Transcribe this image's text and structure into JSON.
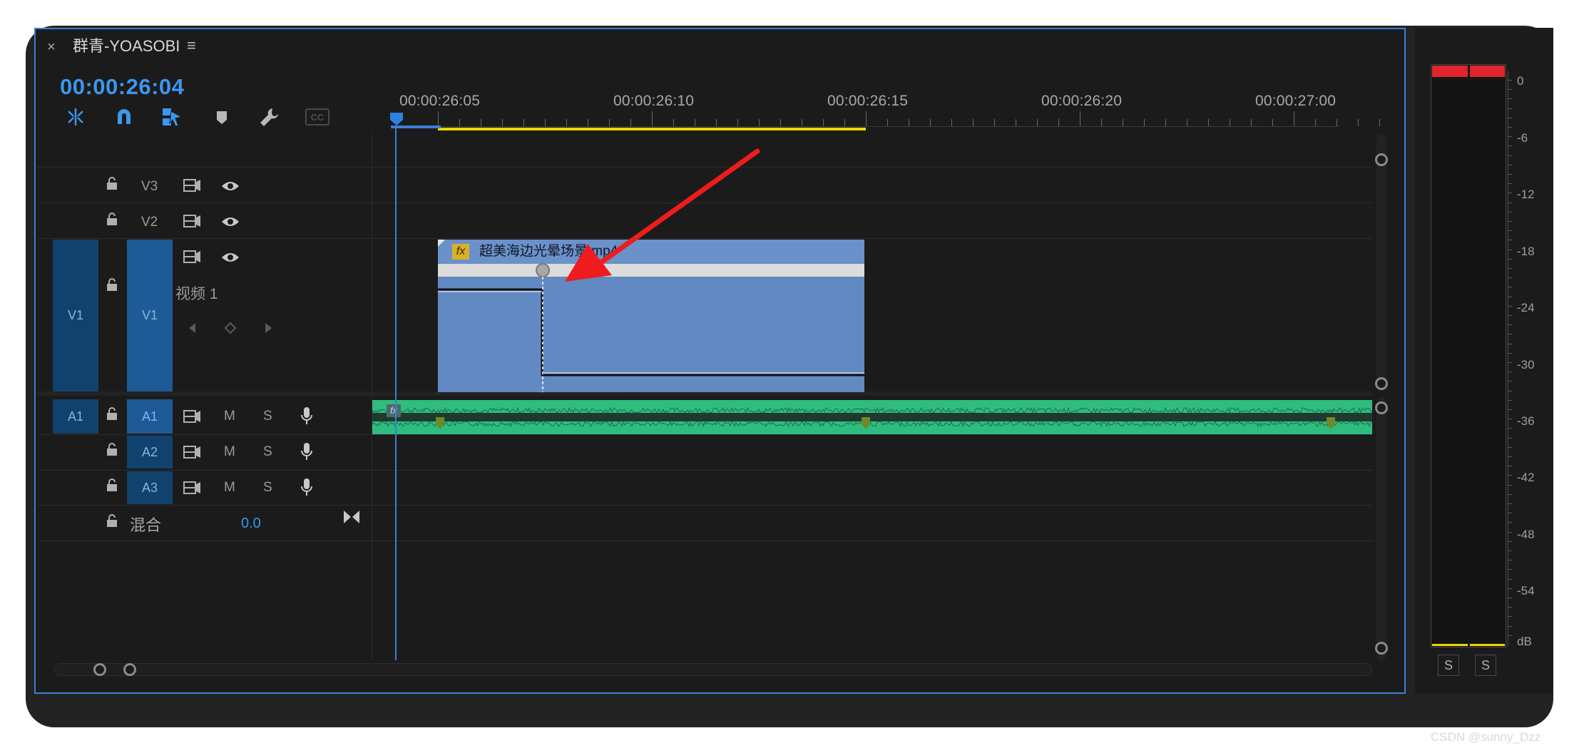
{
  "panel": {
    "close_glyph": "×",
    "title": "群青-YOASOBI",
    "menu_glyph": "≡",
    "timecode": "00:00:26:04"
  },
  "toolbar": {
    "tools": [
      "insert-snap-icon",
      "magnet-snap-icon",
      "linked-selection-icon",
      "add-marker-icon",
      "wrench-settings-icon",
      "captions-icon"
    ],
    "captions_label": "CC"
  },
  "ruler": {
    "labels": [
      "00:00:26:05",
      "00:00:26:10",
      "00:00:26:15",
      "00:00:26:20",
      "00:00:27:00"
    ]
  },
  "tracks": {
    "video": [
      {
        "name": "V3"
      },
      {
        "name": "V2"
      },
      {
        "source": "V1",
        "name": "V1",
        "track_name": "视频 1"
      }
    ],
    "audio": [
      {
        "source": "A1",
        "name": "A1",
        "m": "M",
        "s": "S"
      },
      {
        "name": "A2",
        "m": "M",
        "s": "S"
      },
      {
        "name": "A3",
        "m": "M",
        "s": "S"
      }
    ],
    "mix": {
      "label": "混合",
      "value": "0.0"
    }
  },
  "clip": {
    "fx_badge": "fx",
    "name": "超美海边光晕场景.mp4"
  },
  "audio_clip": {
    "fx_badge": "fx"
  },
  "meters": {
    "labels": [
      "0",
      "-6",
      "-12",
      "-18",
      "-24",
      "-30",
      "-36",
      "-42",
      "-48",
      "-54",
      "dB"
    ],
    "solo_left": "S",
    "solo_right": "S"
  },
  "watermark": "CSDN @sunny_Dzz",
  "colors": {
    "accent": "#3a7fd6",
    "timecode": "#3b97f0",
    "video_clip": "#6289c2",
    "audio_clip": "#2fbd7f",
    "work_area": "#e8d900",
    "meter_peak": "#e0262b",
    "annotation_arrow": "#ee1c1c"
  }
}
